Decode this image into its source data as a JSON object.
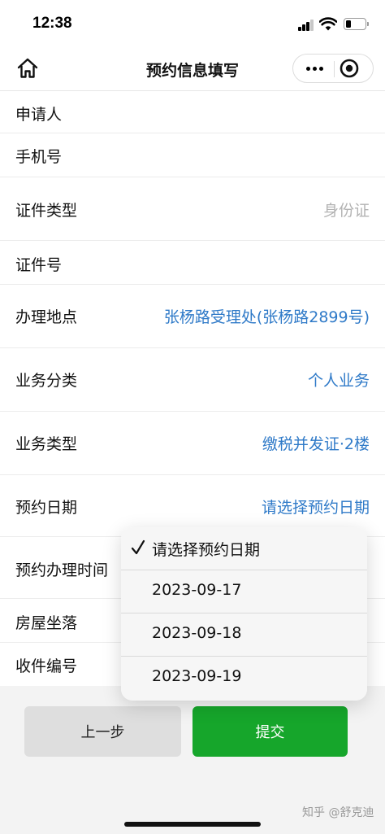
{
  "status_bar": {
    "time": "12:38",
    "battery_level": 0.25
  },
  "nav": {
    "title": "预约信息填写",
    "home_icon": "home-icon",
    "more_icon": "more-icon",
    "close_icon": "close-circle-icon"
  },
  "form": {
    "rows": [
      {
        "label": "申请人",
        "value": ""
      },
      {
        "label": "手机号",
        "value": ""
      },
      {
        "label": "证件类型",
        "value": "身份证"
      },
      {
        "label": "证件号",
        "value": ""
      },
      {
        "label": "办理地点",
        "value": "张杨路受理处(张杨路2899号)"
      },
      {
        "label": "业务分类",
        "value": "个人业务"
      },
      {
        "label": "业务类型",
        "value": "缴税并发证·2楼"
      },
      {
        "label": "预约日期",
        "value": "请选择预约日期"
      },
      {
        "label": "预约办理时间",
        "value": ""
      },
      {
        "label": "房屋坐落",
        "value": ""
      },
      {
        "label": "收件编号",
        "value": ""
      }
    ]
  },
  "date_picker": {
    "selected_index": 0,
    "options": [
      "请选择预约日期",
      "2023-09-17",
      "2023-09-18",
      "2023-09-19"
    ]
  },
  "buttons": {
    "prev": "上一步",
    "submit": "提交"
  },
  "watermark": "知乎 @舒克迪",
  "colors": {
    "accent": "#2f7ac8",
    "submit": "#16a62b",
    "placeholder": "#b3b3b3"
  }
}
